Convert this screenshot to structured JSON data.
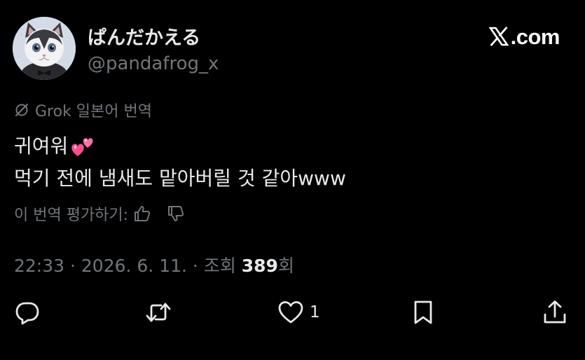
{
  "author": {
    "display_name": "ぱんだかえる",
    "handle": "@pandafrog_x"
  },
  "watermark": {
    "text": ".com"
  },
  "translation": {
    "label": "Grok 일본어 번역",
    "icon": "grok-icon"
  },
  "tweet": {
    "line1": "귀여워",
    "line1_emoji": "two-hearts-emoji",
    "line2": "먹기 전에 냄새도 맡아버릴 것 같아www"
  },
  "rating": {
    "label": "이 번역 평가하기:",
    "icons": [
      "thumbs-up-icon",
      "thumbs-down-icon"
    ]
  },
  "meta": {
    "time": "22:33",
    "separator1": " · ",
    "date": "2026. 6. 11.",
    "separator2": " · ",
    "views_prefix": "조회 ",
    "views_count": "389",
    "views_suffix": "회"
  },
  "actions": {
    "reply_icon": "reply-icon",
    "retweet_icon": "retweet-icon",
    "like_icon": "heart-icon",
    "like_count": "1",
    "bookmark_icon": "bookmark-icon",
    "share_icon": "share-icon"
  },
  "colors": {
    "background": "#000000",
    "primary_text": "#e7e9ea",
    "secondary_text": "#71767b",
    "emoji_pink": "#ff4d8f"
  }
}
